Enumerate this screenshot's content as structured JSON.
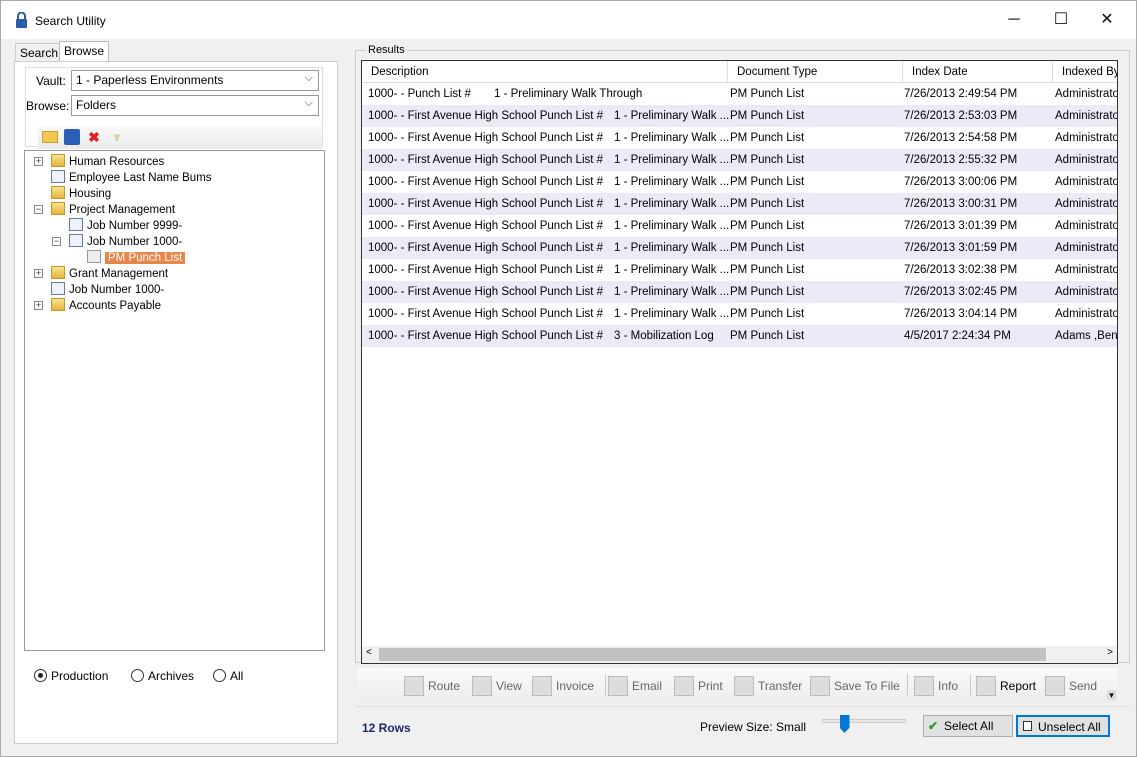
{
  "window": {
    "title": "Search Utility",
    "minimize": "─",
    "maximize": "☐",
    "close": "✕"
  },
  "tabs": [
    {
      "label": "Search"
    },
    {
      "label": "Browse",
      "active": true
    }
  ],
  "browse": {
    "vault_label": "Vault:",
    "vault_value": "1 - Paperless Environments",
    "browse_label": "Browse:",
    "browse_value": "Folders",
    "toolbar_icons": [
      "new-folder-icon",
      "save-icon",
      "delete-icon",
      "folder-tree-icon"
    ]
  },
  "tree": [
    {
      "label": "Human Resources",
      "type": "folder",
      "expander": "+"
    },
    {
      "label": "Employee Last Name Bums",
      "type": "document"
    },
    {
      "label": "Housing",
      "type": "folder"
    },
    {
      "label": "Project Management",
      "type": "folder",
      "expander": "−"
    },
    {
      "label": "Job Number  9999-",
      "type": "document"
    },
    {
      "label": "Job Number  1000-",
      "type": "document",
      "expander": "−"
    },
    {
      "label": "PM Punch List",
      "type": "list",
      "selected": true
    },
    {
      "label": "Grant Management",
      "type": "folder",
      "expander": "+"
    },
    {
      "label": "Job Number  1000-",
      "type": "document"
    },
    {
      "label": "Accounts Payable",
      "type": "folder",
      "expander": "+"
    }
  ],
  "scope": {
    "options": [
      "Production",
      "Archives",
      "All"
    ],
    "selected": "Production"
  },
  "results": {
    "label": "Results",
    "columns": [
      "Description",
      "Document Type",
      "Index Date",
      "Indexed By"
    ],
    "rows": [
      [
        "1000- -  Punch List #",
        "1 - Preliminary Walk Through",
        "PM Punch List",
        "7/26/2013 2:49:54 PM",
        "Administrator"
      ],
      [
        "1000- - First Avenue High School Punch List #",
        "1 - Preliminary Walk ...",
        "PM Punch List",
        "7/26/2013 2:53:03 PM",
        "Administrator"
      ],
      [
        "1000- - First Avenue High School Punch List #",
        "1 - Preliminary Walk ...",
        "PM Punch List",
        "7/26/2013 2:54:58 PM",
        "Administrator"
      ],
      [
        "1000- - First Avenue High School Punch List #",
        "1 - Preliminary Walk ...",
        "PM Punch List",
        "7/26/2013 2:55:32 PM",
        "Administrator"
      ],
      [
        "1000- - First Avenue High School Punch List #",
        "1 - Preliminary Walk ...",
        "PM Punch List",
        "7/26/2013 3:00:06 PM",
        "Administrator"
      ],
      [
        "1000- - First Avenue High School Punch List #",
        "1 - Preliminary Walk ...",
        "PM Punch List",
        "7/26/2013 3:00:31 PM",
        "Administrator"
      ],
      [
        "1000- - First Avenue High School Punch List #",
        "1 - Preliminary Walk ...",
        "PM Punch List",
        "7/26/2013 3:01:39 PM",
        "Administrator"
      ],
      [
        "1000- - First Avenue High School Punch List #",
        "1 - Preliminary Walk ...",
        "PM Punch List",
        "7/26/2013 3:01:59 PM",
        "Administrator"
      ],
      [
        "1000- - First Avenue High School Punch List #",
        "1 - Preliminary Walk ...",
        "PM Punch List",
        "7/26/2013 3:02:38 PM",
        "Administrator"
      ],
      [
        "1000- - First Avenue High School Punch List #",
        "1 - Preliminary Walk ...",
        "PM Punch List",
        "7/26/2013 3:02:45 PM",
        "Administrator"
      ],
      [
        "1000- - First Avenue High School Punch List #",
        "1 - Preliminary Walk ...",
        "PM Punch List",
        "7/26/2013 3:04:14 PM",
        "Administrator"
      ],
      [
        "1000- - First Avenue High School Punch List #",
        "3 - Mobilization Log",
        "PM Punch List",
        "4/5/2017 2:24:34 PM",
        "Adams ,Ben"
      ]
    ]
  },
  "actions": [
    {
      "label": "Route",
      "enabled": false
    },
    {
      "label": "View",
      "enabled": false
    },
    {
      "label": "Invoice",
      "enabled": false
    },
    {
      "label": "Email",
      "enabled": false
    },
    {
      "label": "Print",
      "enabled": false
    },
    {
      "label": "Transfer",
      "enabled": false
    },
    {
      "label": "Save To File",
      "enabled": false
    },
    {
      "label": "Info",
      "enabled": false
    },
    {
      "label": "Report",
      "enabled": true
    },
    {
      "label": "Send",
      "enabled": false
    }
  ],
  "status": {
    "rows": "12 Rows",
    "preview_label": "Preview Size: Small",
    "preview_level": 1,
    "preview_max": 4,
    "select_all": "Select All",
    "unselect_all": "Unselect All"
  },
  "colors": {
    "selected_node": "#e8864a",
    "alt_row": "#ebebf8",
    "rows_text": "#1a2a6c",
    "accent": "#0078d7"
  }
}
